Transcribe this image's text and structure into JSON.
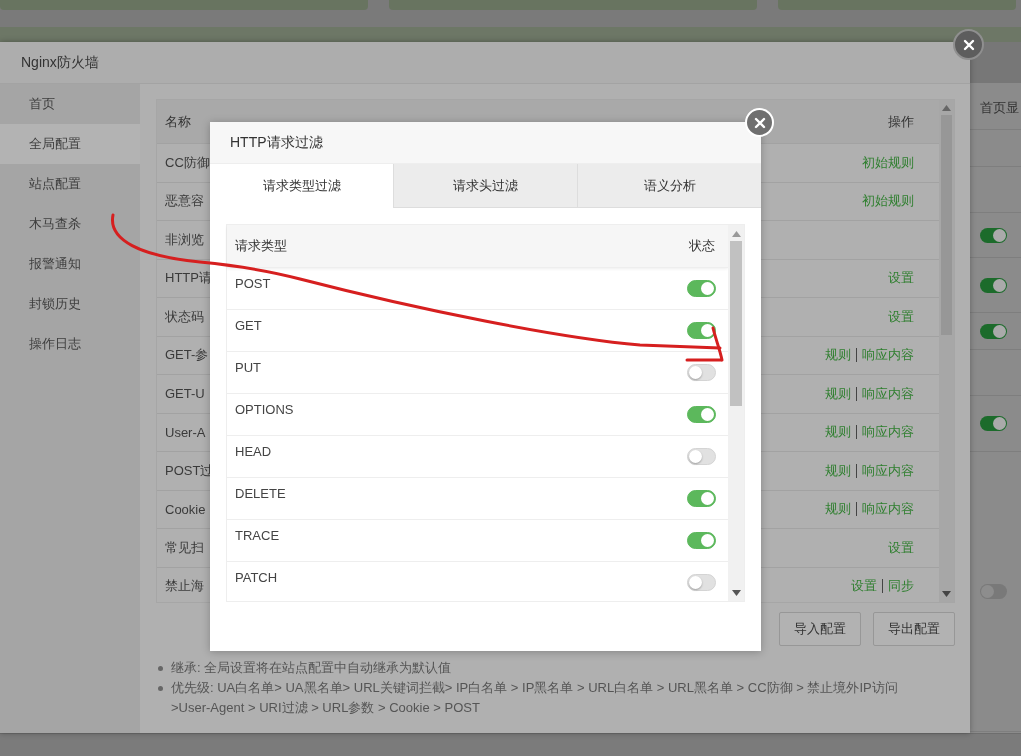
{
  "window": {
    "title": "Nginx防火墙"
  },
  "sidebar": {
    "items": [
      {
        "label": "首页",
        "selected": false
      },
      {
        "label": "全局配置",
        "selected": true
      },
      {
        "label": "站点配置",
        "selected": false
      },
      {
        "label": "木马查杀",
        "selected": false
      },
      {
        "label": "报警通知",
        "selected": false
      },
      {
        "label": "封锁历史",
        "selected": false
      },
      {
        "label": "操作日志",
        "selected": false
      }
    ]
  },
  "rules_table": {
    "columns": [
      "名称",
      "操作"
    ],
    "rows": [
      {
        "name": "CC防御",
        "actions": [
          "初始规则"
        ]
      },
      {
        "name": "恶意容",
        "actions": [
          "初始规则"
        ]
      },
      {
        "name": "非浏览",
        "actions": []
      },
      {
        "name": "HTTP请",
        "actions": [
          "设置"
        ]
      },
      {
        "name": "状态码",
        "actions": [
          "设置"
        ]
      },
      {
        "name": "GET-参",
        "actions": [
          "规则",
          "响应内容"
        ]
      },
      {
        "name": "GET-U",
        "actions": [
          "规则",
          "响应内容"
        ]
      },
      {
        "name": "User-A",
        "actions": [
          "规则",
          "响应内容"
        ]
      },
      {
        "name": "POST过",
        "actions": [
          "规则",
          "响应内容"
        ]
      },
      {
        "name": "Cookie",
        "actions": [
          "规则",
          "响应内容"
        ]
      },
      {
        "name": "常见扫",
        "actions": [
          "设置"
        ]
      },
      {
        "name": "禁止海",
        "actions": [
          "设置",
          "同步"
        ]
      }
    ]
  },
  "buttons": [
    "导入配置",
    "导出配置"
  ],
  "notes": [
    "继承: 全局设置将在站点配置中自动继承为默认值",
    "优先级: UA白名单> UA黑名单> URL关键词拦截> IP白名单 > IP黑名单 > URL白名单 > URL黑名单 > CC防御 > 禁止境外IP访问 >User-Agent > URI过滤 > URL参数 > Cookie > POST"
  ],
  "side_list": {
    "header": "首页显",
    "toggles": [
      {
        "on": true
      },
      {
        "on": true
      },
      {
        "on": true
      },
      {
        "on": true
      },
      {
        "on": false
      }
    ]
  },
  "dialog": {
    "title": "HTTP请求过滤",
    "tabs": [
      {
        "label": "请求类型过滤",
        "selected": true
      },
      {
        "label": "请求头过滤",
        "selected": false
      },
      {
        "label": "语义分析",
        "selected": false
      }
    ],
    "table": {
      "columns": [
        "请求类型",
        "状态"
      ],
      "rows": [
        {
          "method": "POST",
          "on": true
        },
        {
          "method": "GET",
          "on": true
        },
        {
          "method": "PUT",
          "on": false
        },
        {
          "method": "OPTIONS",
          "on": true
        },
        {
          "method": "HEAD",
          "on": false
        },
        {
          "method": "DELETE",
          "on": true
        },
        {
          "method": "TRACE",
          "on": true
        },
        {
          "method": "PATCH",
          "on": false
        }
      ]
    }
  }
}
